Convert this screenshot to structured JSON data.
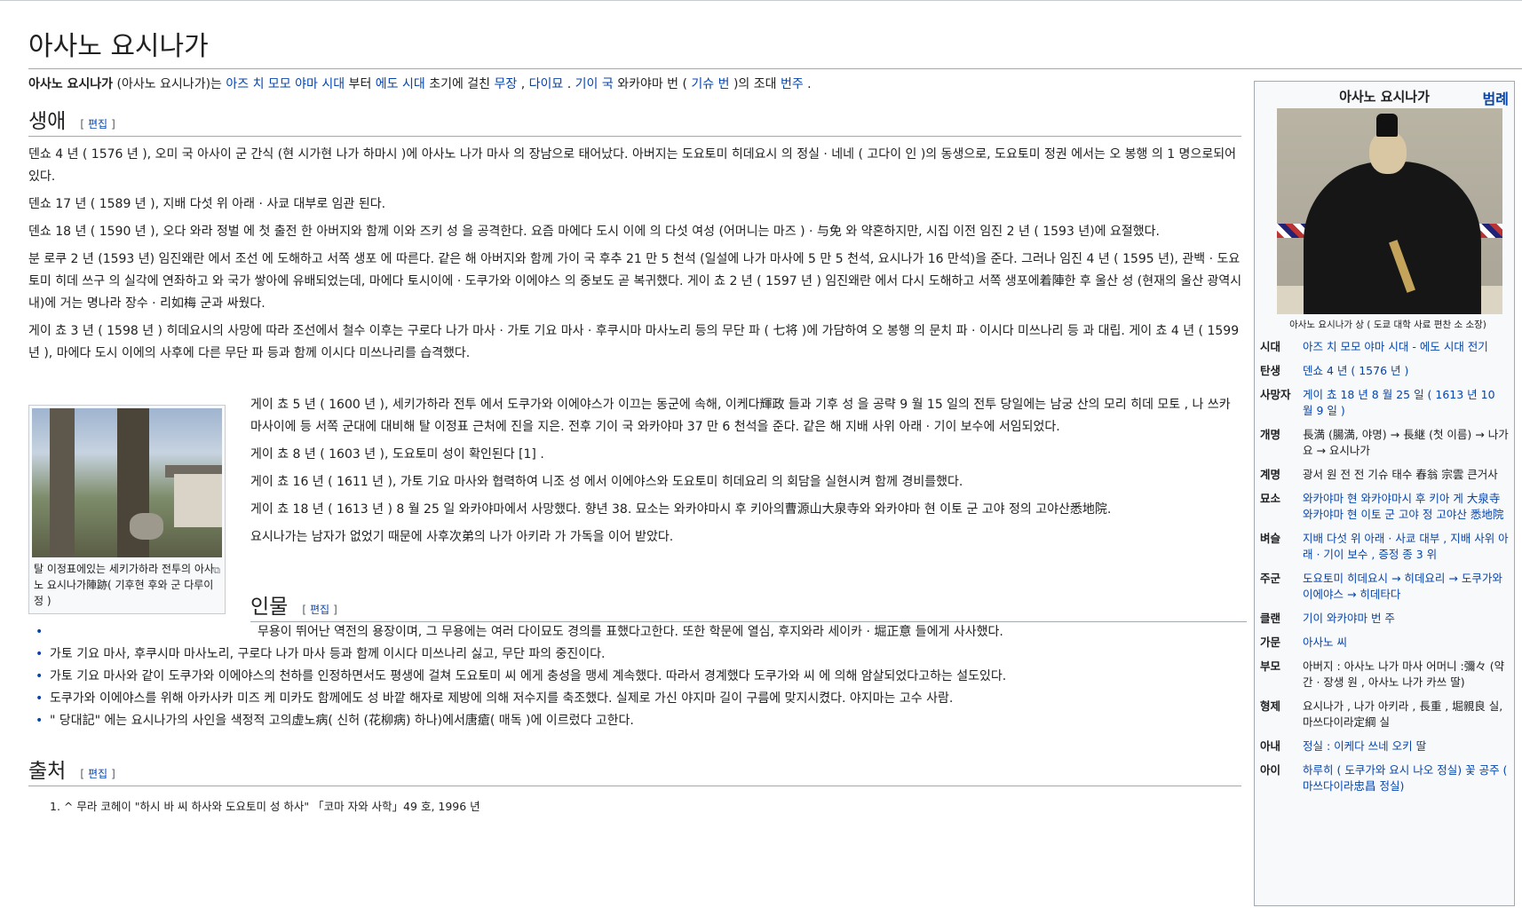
{
  "title": "아사노 요시나가",
  "lead": {
    "bold": "아사노 요시나가",
    "t1": " (아사노 요시나가)는 ",
    "l1": "아즈 치 모모 야마 시대",
    "t2": " 부터 ",
    "l2": "에도 시대",
    "t3": " 초기에 걸친 ",
    "l3": "무장",
    "t4": " , ",
    "l4": "다이묘",
    "t5": " . ",
    "l5": "기이 국",
    "t6": " 와카야마 번 ( ",
    "l6": "기슈 번",
    "t7": " )의 조대 ",
    "l7": "번주",
    "t8": " ."
  },
  "edit_label": "편집",
  "sections": {
    "life": "생애",
    "person": "인물",
    "source": "출처"
  },
  "life": {
    "p1": "덴쇼 4 년 ( 1576 년 ), 오미 국 아사이 군 간식 (현 시가현 나가 하마시 )에 아사노 나가 마사 의 장남으로 태어났다. 아버지는 도요토미 히데요시 의 정실 · 네네 ( 고다이 인 )의 동생으로, 도요토미 정권 에서는 오 봉행 의 1 명으로되어있다.",
    "p2": "덴쇼 17 년 ( 1589 년 ), 지배 다섯 위 아래 · 사쿄 대부로 임관 된다.",
    "p3": "덴쇼 18 년 ( 1590 년 ), 오다 와라 정벌 에 첫 출전 한 아버지와 함께 이와 즈키 성 을 공격한다. 요즘 마에다 도시 이에 의 다섯 여성 (어머니는 마즈 ) · 与免 와 약혼하지만, 시집 이전 임진 2 년 ( 1593 년)에 요절했다.",
    "p4": "분 로쿠 2 년 (1593 년) 임진왜란 에서 조선 에 도해하고 서쪽 생포 에 따른다. 같은 해 아버지와 함께 가이 국 후추 21 만 5 천석 (일설에 나가 마사에 5 만 5 천석, 요시나가 16 만석)을 준다. 그러나 임진 4 년 ( 1595 년), 관백 · 도요토미 히데 쓰구 의 실각에 연좌하고 와 국가 쌓아에 유배되었는데, 마에다 토시이에 · 도쿠가와 이에야스 의 중보도 곧 복귀했다. 게이 쵸 2 년 ( 1597 년 ) 임진왜란 에서 다시 도해하고 서쪽 생포에着陣한 후 울산 성 (현재의 울산 광역시 내)에 거는 명나라 장수 · 리如梅 군과 싸웠다.",
    "p5": "게이 쵸 3 년 ( 1598 년 ) 히데요시의 사망에 따라 조선에서 철수 이후는 구로다 나가 마사 · 가토 기요 마사 · 후쿠시마 마사노리 등의 무단 파 ( 七将 )에 가담하여 오 봉행 의 문치 파 · 이시다 미쓰나리 등 과 대립. 게이 쵸 4 년 ( 1599 년 ), 마에다 도시 이에의 사후에 다른 무단 파 등과 함께 이시다 미쓰나리를 습격했다.",
    "p6": "게이 쵸 5 년 ( 1600 년 ), 세키가하라 전투 에서 도쿠가와 이에야스가 이끄는 동군에 속해, 이케다輝政 들과 기후 성 을 공략 9 월 15 일의 전투 당일에는 남궁 산의 모리 히데 모토 , 나 쓰카 마사이에 등 서쪽 군대에 대비해 탈 이정표 근처에 진을 지은. 전후 기이 국 와카야마 37 만 6 천석을 준다. 같은 해 지배 사위 아래 · 기이 보수에 서임되었다.",
    "p7": "게이 쵸 8 년 ( 1603 년 ), 도요토미 성이 확인된다 [1] .",
    "p8": "게이 쵸 16 년 ( 1611 년 ), 가토 기요 마사와 협력하여 니조 성 에서 이에야스와 도요토미 히데요리 의 회담을 실현시켜 함께 경비를했다.",
    "p9": "게이 쵸 18 년 ( 1613 년 ) 8 월 25 일 와카야마에서 사망했다. 향년 38. 묘소는 와카야마시 후 키아의曹源山大泉寺와 와카야마 현 이토 군 고야 정의 고야산悉地院.",
    "p10": "요시나가는 남자가 없었기 때문에 사후次弟의 나가 아키라 가 가독을 이어 받았다."
  },
  "thumb": {
    "caption": "탈 이정표에있는 세키가하라 전투의 아사노 요시나가陣跡( 기후현 후와 군 다루이 정 )"
  },
  "person_items": [
    "무용이 뛰어난 역전의 용장이며, 그 무용에는 여러 다이묘도 경의를 표했다고한다. 또한 학문에 열심, 후지와라 세이카 · 堀正意 들에게 사사했다.",
    "가토 기요 마사, 후쿠시마 마사노리, 구로다 나가 마사 등과 함께 이시다 미쓰나리 싫고, 무단 파의 중진이다.",
    "가토 기요 마사와 같이 도쿠가와 이에야스의 천하를 인정하면서도 평생에 걸쳐 도요토미 씨 에게 충성을 맹세 계속했다. 따라서 경계했다 도쿠가와 씨 에 의해 암살되었다고하는 설도있다.",
    "도쿠가와 이에야스를 위해 아카사카 미즈 케 미카도 함께에도 성 바깥 해자로 제방에 의해 저수지를 축조했다. 실제로 가신 야지마 길이 구름에 맞지시켰다. 야지마는 고수 사람.",
    "\" 당대記\" 에는 요시나가의 사인을 색정적 고의虚노病( 신허 (花柳病) 하나)에서唐瘡( 매독 )에 이르렀다 고한다."
  ],
  "refs": [
    "^ 무라 코헤이 \"하시 바 씨 하사와 도요토미 성 하사\" 「코마 자와 사학」49 호, 1996 년"
  ],
  "infobox": {
    "title": "아사노 요시나가",
    "legend": "범례",
    "portrait_caption": "아사노 요시나가 상 ( 도쿄 대학 사료 편찬 소 소장)",
    "rows": [
      {
        "label": "시대",
        "value": "아즈 치 모모 야마 시대 - 에도 시대 전기"
      },
      {
        "label": "탄생",
        "value": "덴쇼 4 년 ( 1576 년 )"
      },
      {
        "label": "사망자",
        "value": "게이 쵸 18 년 8 월 25 일 ( 1613 년 10 월 9 일 )"
      },
      {
        "label": "개명",
        "value": "長満 (腸満, 야명) → 長継 (첫 이름) → 나가요 → 요시나가"
      },
      {
        "label": "계명",
        "value": "광서 원 전 전 기슈 태수 春翁 宗雲 큰거사"
      },
      {
        "label": "묘소",
        "value": "와카야마 현 와카야마시 후 키아 게 大泉寺 와카야마 현 이토 군 고야 정 고야산 悉地院"
      },
      {
        "label": "벼슬",
        "value": "지배 다섯 위 아래 · 사쿄 대부 , 지배 사위 아래 · 기이 보수 , 증정 종 3 위"
      },
      {
        "label": "주군",
        "value": "도요토미 히데요시 → 히데요리 → 도쿠가와 이에야스 → 히데타다"
      },
      {
        "label": "클랜",
        "value": "기이 와카야마 번 주"
      },
      {
        "label": "가문",
        "value": "아사노 씨"
      },
      {
        "label": "부모",
        "value": "아버지 : 아사노 나가 마사 어머니 :彌々 (약간 · 장생 원 , 아사노 나가 카쓰 딸)"
      },
      {
        "label": "형제",
        "value": "요시나가 , 나가 아키라 , 長重 , 堀親良 실, 마쓰다이라定綱 실"
      },
      {
        "label": "아내",
        "value": "정실 : 이케다 쓰네 오키 딸"
      },
      {
        "label": "아이",
        "value": "하루히 ( 도쿠가와 요시 나오 정실) 꽃 공주 ( 마쓰다이라忠昌 정실)"
      }
    ]
  }
}
